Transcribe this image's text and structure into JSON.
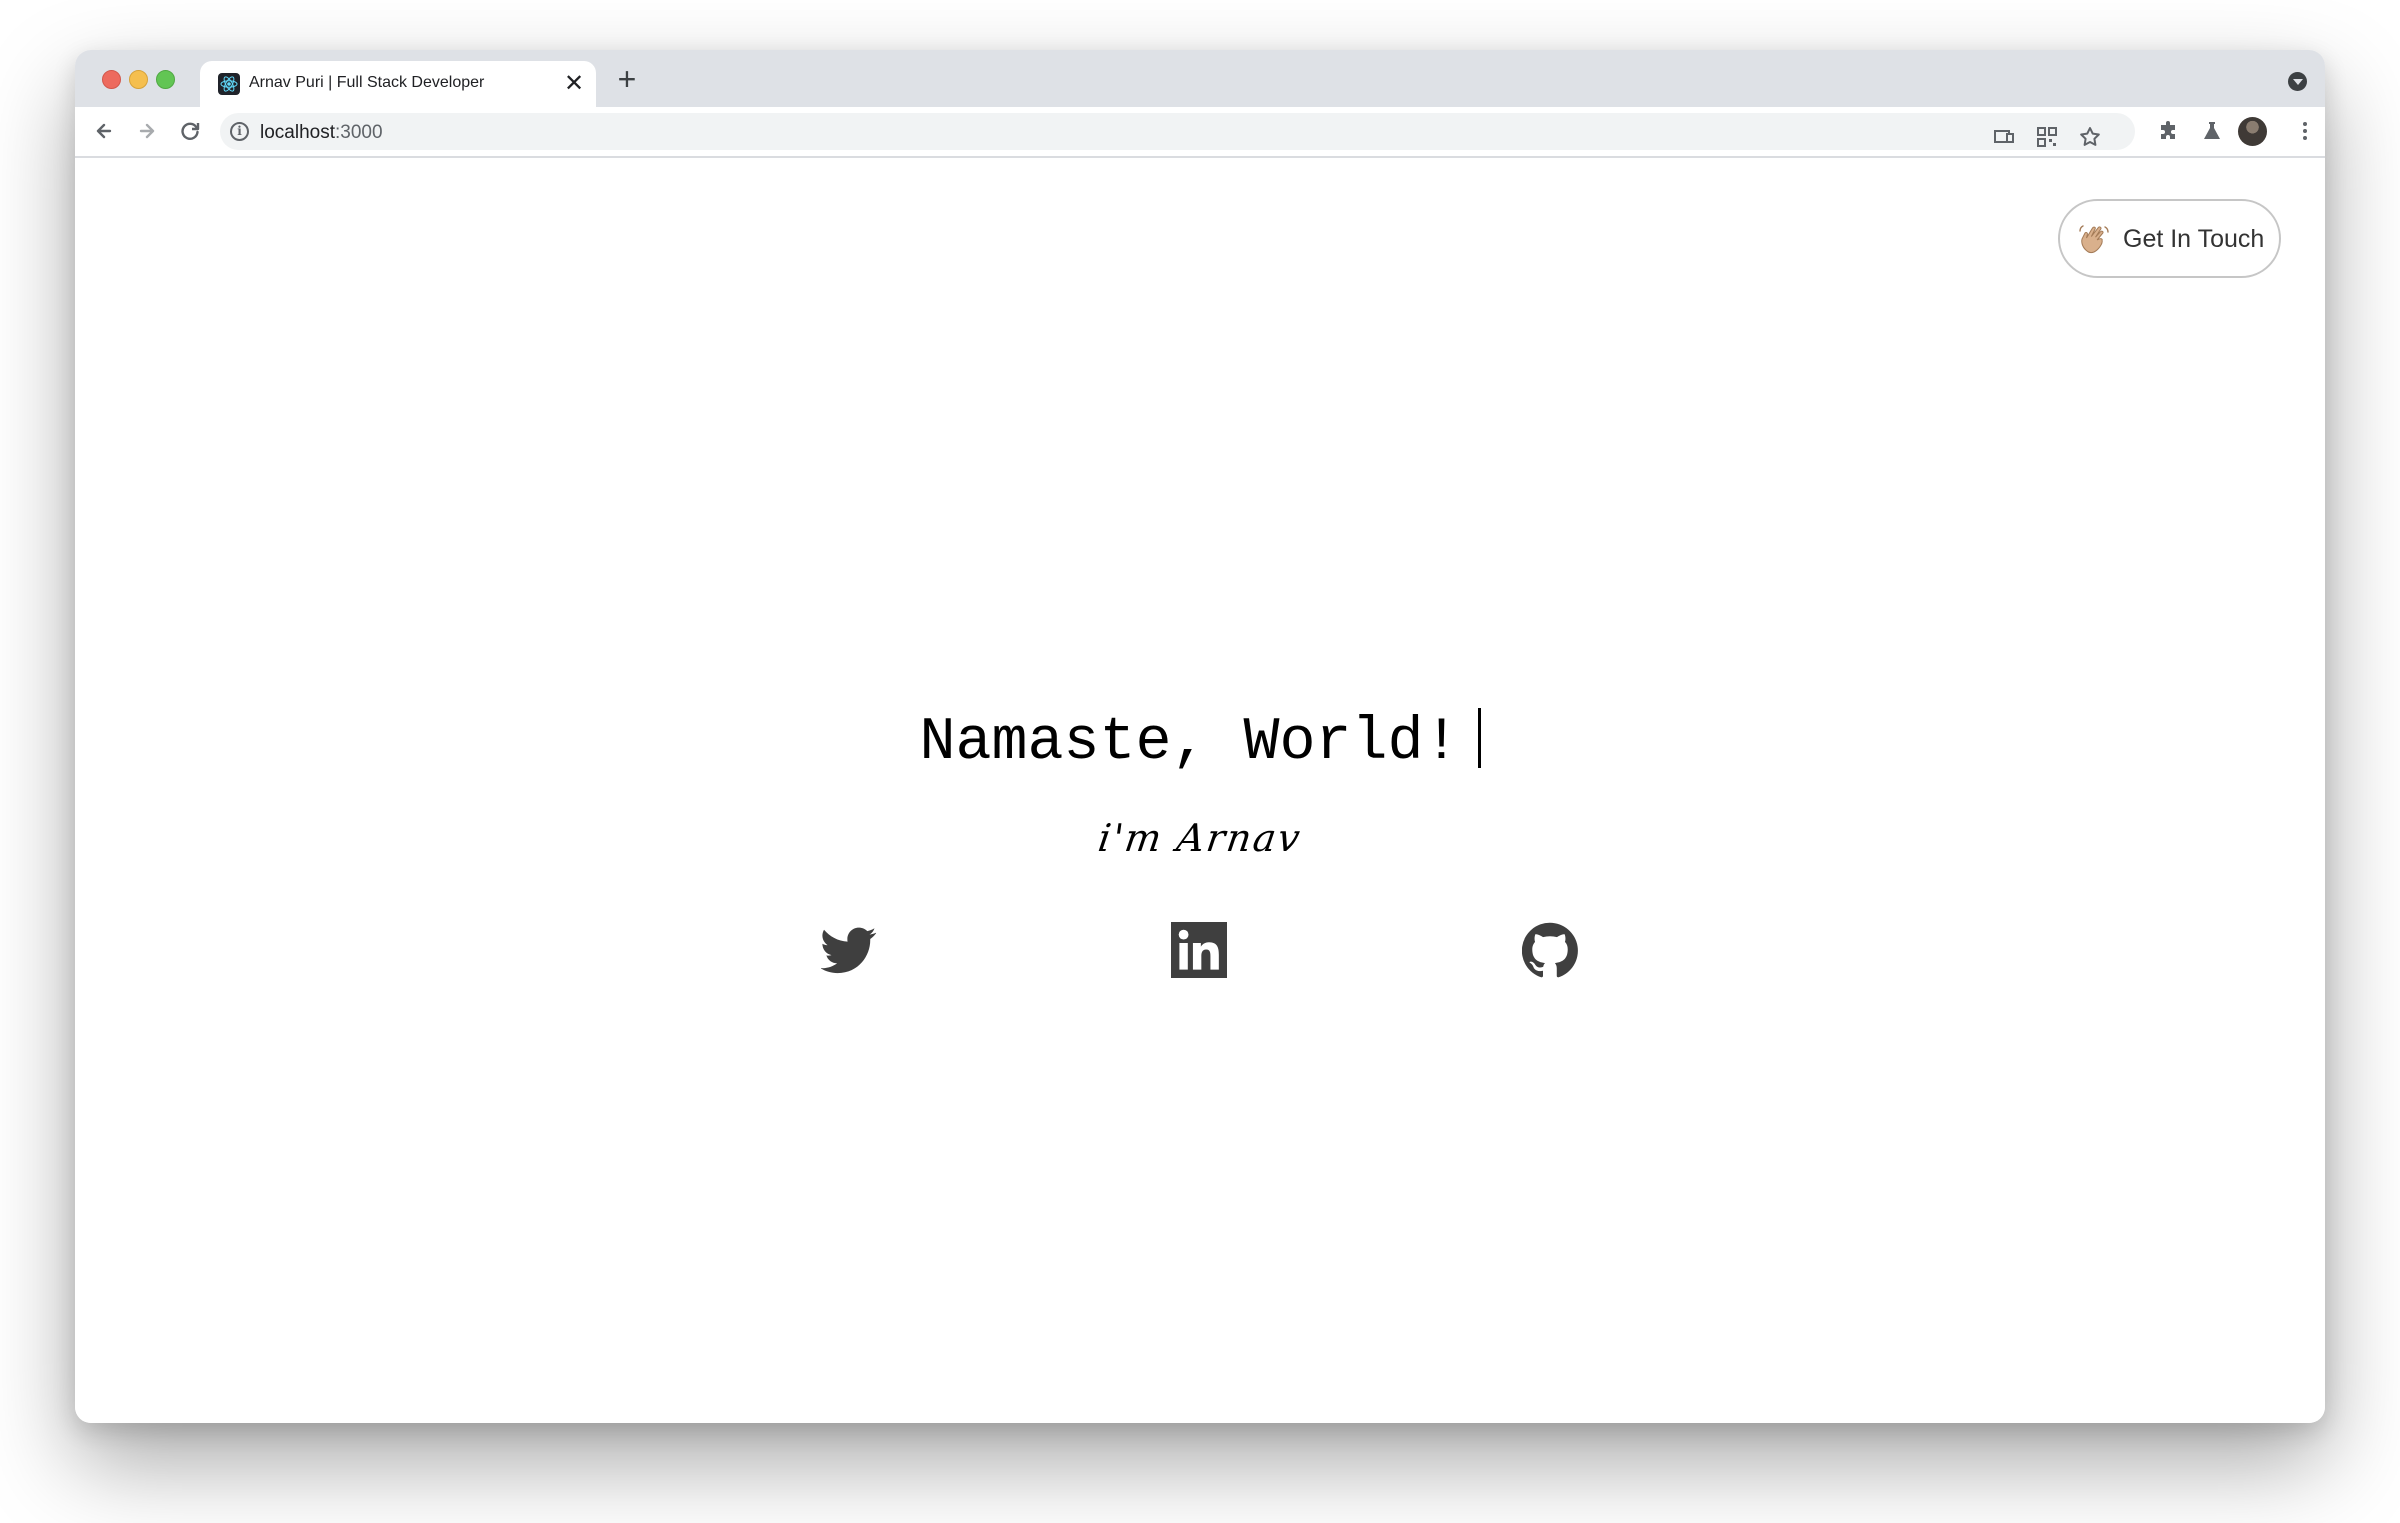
{
  "browser": {
    "tab_title": "Arnav Puri | Full Stack Developer",
    "close_tab_symbol": "✕",
    "new_tab_symbol": "+",
    "url_host": "localhost",
    "url_port": ":3000"
  },
  "header": {
    "contact_button_label": "Get In Touch",
    "contact_button_icon": "waving-hand-icon"
  },
  "hero": {
    "title": "Namaste, World!",
    "subtitle": "i'm Arnav"
  },
  "social_links": [
    {
      "name": "twitter",
      "icon": "twitter-icon"
    },
    {
      "name": "linkedin",
      "icon": "linkedin-icon"
    },
    {
      "name": "github",
      "icon": "github-icon"
    }
  ],
  "colors": {
    "icon_gray": "#3f3f3f",
    "button_border": "#c6c6c6",
    "text": "#000000"
  }
}
